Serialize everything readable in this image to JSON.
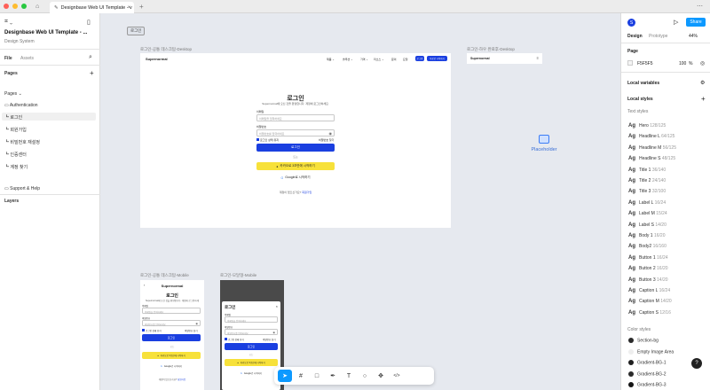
{
  "tab": {
    "title": "Designbase Web UI Template - v"
  },
  "left": {
    "file_title": "Designbase Web UI Template - ...",
    "file_sub": "Design System",
    "tabs": [
      "File",
      "Assets"
    ],
    "pages_header": "Pages",
    "pages": [
      "Pages ⌄",
      "Authentication",
      "┗ 로그인",
      "┗ 회원가입",
      "┗ 비밀번호 재설정",
      "┗ 인증센터",
      "┗ 계정 찾기",
      "Support & Help"
    ],
    "layers_header": "Layers"
  },
  "canvas": {
    "tag": "로그인",
    "labels": {
      "desktop": "로그인-공통 데스크탑-Desktop",
      "desktop2": "로그인-하우 완료후-Desktop",
      "mobile1": "로그인-공통 데스크탑-Mobile",
      "mobile2": "로그인-모달형-Mobile"
    },
    "brand": "Supernormal",
    "nav": [
      "제품 ⌄",
      "솔루션 ⌄",
      "가격 ⌄",
      "리소스 ⌄",
      "문의",
      "요청",
      "로그인",
      "무료로 시작하기"
    ],
    "login_title": "로그인",
    "login_sub": "Supernormal에 오신 것을 환영합니다. 계정에 로그인하세요.",
    "email_label": "이메일",
    "email_placeholder": "이메일을 입력하세요",
    "pw_label": "비밀번호",
    "pw_placeholder": "비밀번호를 입력하세요",
    "remember": "로그인 상태 유지",
    "forgot": "비밀번호 찾기",
    "login_btn": "로그인",
    "or": "또는",
    "kakao_btn": "카카오로 3초만에 시작하기",
    "google_btn": "Google로 시작하기",
    "signup_q": "계정이 없으신가요?",
    "signup_link": "회원가입",
    "placeholder": "Placeholder"
  },
  "right": {
    "avatar": "S",
    "share": "Share",
    "tabs": [
      "Design",
      "Prototype"
    ],
    "zoom": "44%",
    "page_header": "Page",
    "page_color": "F5F5F5",
    "page_opacity": "100",
    "page_opacity_unit": "%",
    "local_variables": "Local variables",
    "local_styles": "Local styles",
    "text_styles_header": "Text styles",
    "text_styles": [
      {
        "name": "Hero",
        "spec": "128/125"
      },
      {
        "name": "Headline L",
        "spec": "64/125"
      },
      {
        "name": "Headline M",
        "spec": "56/125"
      },
      {
        "name": "Headline S",
        "spec": "48/125"
      },
      {
        "name": "Title 1",
        "spec": "36/140"
      },
      {
        "name": "Title 2",
        "spec": "24/140"
      },
      {
        "name": "Title 3",
        "spec": "32/100"
      },
      {
        "name": "Label L",
        "spec": "16/24"
      },
      {
        "name": "Label M",
        "spec": "15/24"
      },
      {
        "name": "Label S",
        "spec": "14/20"
      },
      {
        "name": "Body 1",
        "spec": "16/20"
      },
      {
        "name": "Body2",
        "spec": "16/160"
      },
      {
        "name": "Button 1",
        "spec": "16/24"
      },
      {
        "name": "Button 2",
        "spec": "16/20"
      },
      {
        "name": "Button 3",
        "spec": "14/20"
      },
      {
        "name": "Caption L",
        "spec": "16/24"
      },
      {
        "name": "Caption M",
        "spec": "14/20"
      },
      {
        "name": "Caption S",
        "spec": "12/16"
      }
    ],
    "color_styles_header": "Color styles",
    "color_styles": [
      {
        "name": "Section-bg",
        "color": "#2a2a2a"
      },
      {
        "name": "Empty Image Area",
        "color": "#eeeeee"
      },
      {
        "name": "Gradient-BG-1",
        "color": "#1f1f1f"
      },
      {
        "name": "Gradient-BG-2",
        "color": "#2b2b2b"
      },
      {
        "name": "Gradient-BG-3",
        "color": "#151515"
      }
    ],
    "help": "?"
  },
  "colors": {
    "primary": "#1a3fe0",
    "kakao": "#f7e13a",
    "accent": "#0d99ff"
  }
}
